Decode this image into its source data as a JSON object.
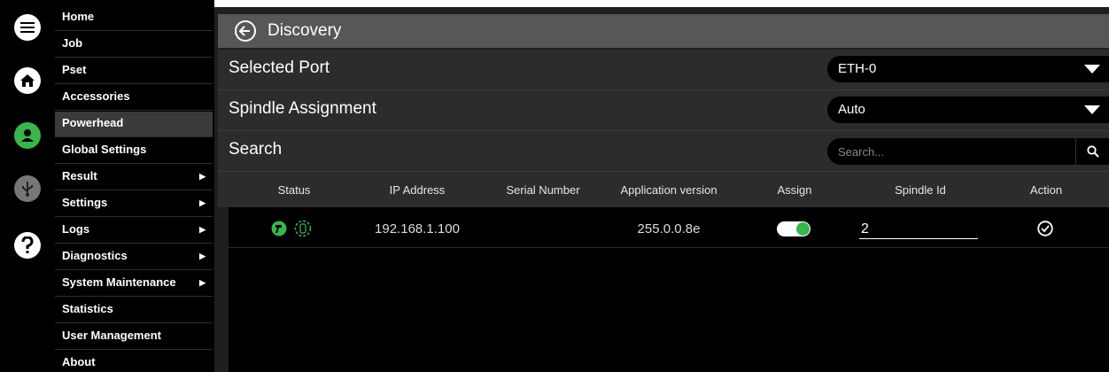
{
  "rail": {
    "icons": [
      "menu-icon",
      "home-icon",
      "user-icon",
      "usb-icon",
      "help-icon"
    ]
  },
  "nav": {
    "items": [
      {
        "label": "Home",
        "submenu": false
      },
      {
        "label": "Job",
        "submenu": false
      },
      {
        "label": "Pset",
        "submenu": false
      },
      {
        "label": "Accessories",
        "submenu": false
      },
      {
        "label": "Powerhead",
        "submenu": false,
        "active": true
      },
      {
        "label": "Global Settings",
        "submenu": false
      },
      {
        "label": "Result",
        "submenu": true
      },
      {
        "label": "Settings",
        "submenu": true
      },
      {
        "label": "Logs",
        "submenu": true
      },
      {
        "label": "Diagnostics",
        "submenu": true
      },
      {
        "label": "System Maintenance",
        "submenu": true
      },
      {
        "label": "Statistics",
        "submenu": false
      },
      {
        "label": "User Management",
        "submenu": false
      },
      {
        "label": "About",
        "submenu": false
      }
    ],
    "caret": "▶"
  },
  "header": {
    "title": "Discovery"
  },
  "selected_port": {
    "label": "Selected Port",
    "value": "ETH-0"
  },
  "spindle_assignment": {
    "label": "Spindle Assignment",
    "value": "Auto"
  },
  "search": {
    "label": "Search",
    "placeholder": "Search..."
  },
  "table": {
    "columns": [
      "Status",
      "IP Address",
      "Serial Number",
      "Application version",
      "Assign",
      "Spindle Id",
      "Action"
    ],
    "rows": [
      {
        "status_icons": [
          "tool-connected-icon",
          "tool-outline-icon"
        ],
        "ip": "192.168.1.100",
        "serial": "",
        "app_version": "255.0.0.8e",
        "assign": true,
        "spindle_id": "2",
        "action_icon": "check-circle-icon"
      }
    ]
  },
  "colors": {
    "accent_green": "#3ab54a",
    "header_bg": "#575757",
    "panel_bg": "#2c2c2c",
    "rail_bg": "#000000"
  }
}
